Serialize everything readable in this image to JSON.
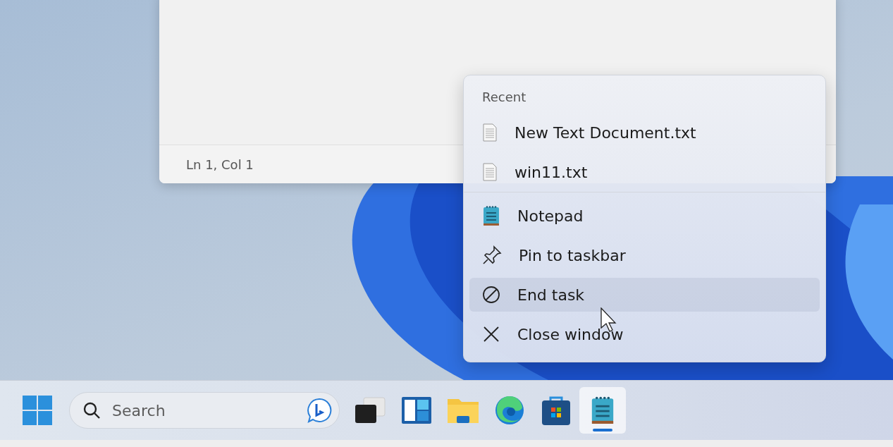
{
  "notepad_window": {
    "status_bar": {
      "position": "Ln 1, Col 1"
    }
  },
  "jump_list": {
    "header": "Recent",
    "recent": [
      {
        "label": "New Text Document.txt",
        "highlighted": false
      },
      {
        "label": "win11.txt",
        "highlighted": false
      }
    ],
    "actions": [
      {
        "kind": "app",
        "label": "Notepad",
        "highlighted": false
      },
      {
        "kind": "pin",
        "label": "Pin to taskbar",
        "highlighted": false
      },
      {
        "kind": "end",
        "label": "End task",
        "highlighted": true
      },
      {
        "kind": "close",
        "label": "Close window",
        "highlighted": false
      }
    ]
  },
  "taskbar": {
    "search": {
      "placeholder": "Search"
    },
    "apps": [
      {
        "kind": "taskview",
        "selected": false
      },
      {
        "kind": "widgets",
        "selected": false
      },
      {
        "kind": "explorer",
        "selected": false
      },
      {
        "kind": "edge",
        "selected": false
      },
      {
        "kind": "store",
        "selected": false
      },
      {
        "kind": "notepad",
        "selected": true
      }
    ]
  }
}
